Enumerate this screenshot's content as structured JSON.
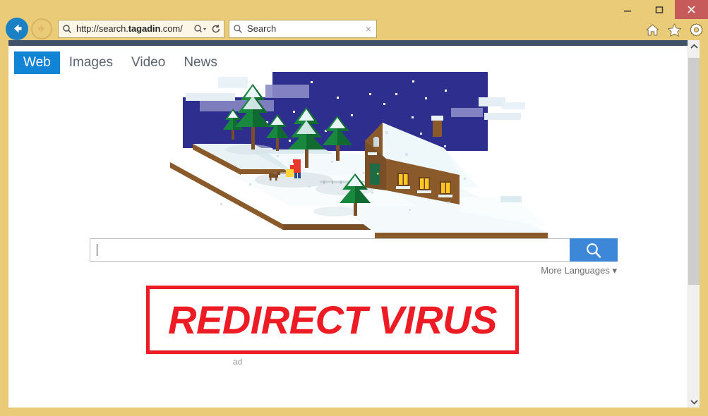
{
  "window": {
    "controls": [
      {
        "name": "minimize",
        "glyph": "minimize-icon"
      },
      {
        "name": "maximize",
        "glyph": "maximize-icon"
      },
      {
        "name": "close",
        "glyph": "close-icon"
      }
    ],
    "close_color": "#C75B5B"
  },
  "browser": {
    "back_label": "Back",
    "forward_label": "Forward",
    "address": {
      "url_prefix": "http://search.",
      "url_domain": "tagadin",
      "url_suffix": ".com/",
      "full_url": "http://search.tagadin.com/",
      "search_icon": "magnifier-icon",
      "dropdown_icon": "chevron-down-icon",
      "refresh_icon": "refresh-icon"
    },
    "search_box": {
      "placeholder": "Search",
      "value": "Search",
      "icon": "magnifier-icon",
      "clear_glyph": "×"
    },
    "toolbar_icons": [
      {
        "name": "home-icon",
        "label": "Home"
      },
      {
        "name": "star-icon",
        "label": "Favorites"
      },
      {
        "name": "gear-icon",
        "label": "Tools"
      }
    ]
  },
  "page": {
    "top_strip_color": "#3F5267",
    "tabs": [
      {
        "label": "Web",
        "active": true
      },
      {
        "label": "Images",
        "active": false
      },
      {
        "label": "Video",
        "active": false
      },
      {
        "label": "News",
        "active": false
      }
    ],
    "active_tab_color": "#1284D6",
    "search": {
      "value": "",
      "placeholder": "",
      "button_icon": "magnifier-icon",
      "button_color": "#3C87D8",
      "more_languages_label": "More Languages ▾"
    },
    "faint_label": "ad",
    "illustration": {
      "name": "isometric-winter-cabin-scene",
      "sky_color": "#2E2E8F",
      "snow_color": "#EAF4F6",
      "cabin_color": "#8B5A2B",
      "tree_color": "#17883E",
      "window_glow": "#FFC425",
      "person_jacket": "#E8392E",
      "star_count": 14
    }
  },
  "overlay": {
    "stamp_text": "REDIRECT VIRUS",
    "stamp_color": "#ED1C24"
  },
  "scrollbar": {
    "up_glyph": "chevron-up-icon",
    "down_glyph": "chevron-down-icon",
    "thumb_label": "scroll-thumb"
  }
}
